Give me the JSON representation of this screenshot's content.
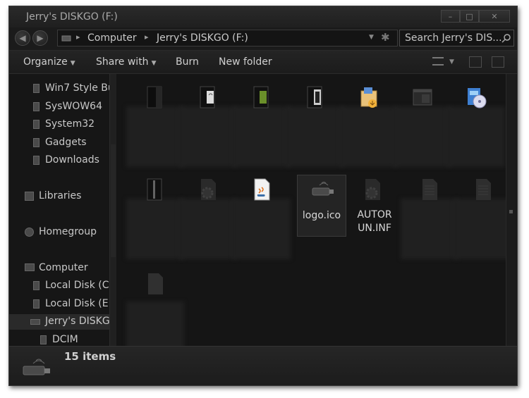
{
  "window": {
    "title": "Jerry's DISKGO (F:)"
  },
  "address": {
    "breadcrumbs": [
      "Computer",
      "Jerry's DISKGO (F:)"
    ]
  },
  "search": {
    "placeholder": "Search Jerry's DIS..."
  },
  "toolbar": {
    "organize": "Organize",
    "share_with": "Share with",
    "burn": "Burn",
    "new_folder": "New folder"
  },
  "sidebar": {
    "items": [
      {
        "label": "Win7 Style Bu",
        "icon": "folder-icon"
      },
      {
        "label": "SysWOW64",
        "icon": "folder-icon"
      },
      {
        "label": "System32",
        "icon": "folder-icon"
      },
      {
        "label": "Gadgets",
        "icon": "folder-icon"
      },
      {
        "label": "Downloads",
        "icon": "folder-icon"
      },
      {
        "label": "Libraries",
        "icon": "library-icon"
      },
      {
        "label": "Homegroup",
        "icon": "homegroup-icon"
      },
      {
        "label": "Computer",
        "icon": "computer-icon"
      },
      {
        "label": "Local Disk (C:",
        "icon": "disk-icon"
      },
      {
        "label": "Local Disk (E:",
        "icon": "disk-icon"
      },
      {
        "label": "Jerry's DISKG",
        "icon": "usb-drive-icon"
      },
      {
        "label": "DCIM",
        "icon": "folder-icon"
      }
    ]
  },
  "files": [
    {
      "name": "",
      "icon": "dark-folder-icon"
    },
    {
      "name": "",
      "icon": "folder-with-document-icon"
    },
    {
      "name": "",
      "icon": "green-folder-icon"
    },
    {
      "name": "",
      "icon": "dark-folder-icon"
    },
    {
      "name": "",
      "icon": "installer-box-icon"
    },
    {
      "name": "",
      "icon": "window-icon"
    },
    {
      "name": "",
      "icon": "setup-cd-icon"
    },
    {
      "name": "",
      "icon": "zip-folder-icon"
    },
    {
      "name": "",
      "icon": "gear-file-icon"
    },
    {
      "name": "",
      "icon": "java-file-icon"
    },
    {
      "name": "logo.ico",
      "icon": "usb-drive-icon"
    },
    {
      "name": "AUTORUN.INF",
      "name_line1": "AUTOR",
      "name_line2": "UN.INF",
      "icon": "gear-file-icon"
    },
    {
      "name": "",
      "icon": "text-file-icon"
    },
    {
      "name": "",
      "icon": "text-file-icon"
    },
    {
      "name": "",
      "icon": "blank-file-icon"
    }
  ],
  "status": {
    "count": "15 items"
  },
  "colors": {
    "background": "#1a1a1a",
    "text": "#d0d0d0",
    "selection": "#242424"
  }
}
